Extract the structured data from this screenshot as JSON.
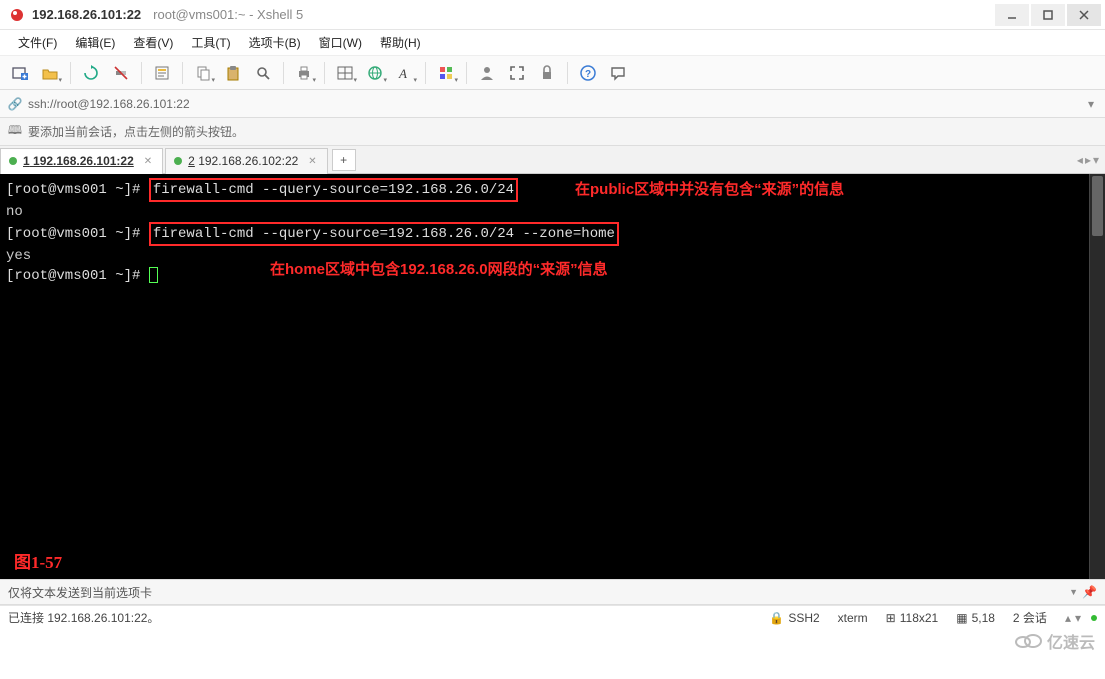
{
  "window": {
    "title_main": "192.168.26.101:22",
    "title_sub": "root@vms001:~ - Xshell 5"
  },
  "menu": {
    "file": "文件(F)",
    "edit": "编辑(E)",
    "view": "查看(V)",
    "tools": "工具(T)",
    "tabs": "选项卡(B)",
    "window": "窗口(W)",
    "help": "帮助(H)"
  },
  "address": {
    "url": "ssh://root@192.168.26.101:22"
  },
  "hint": {
    "text": "要添加当前会话，点击左侧的箭头按钮。"
  },
  "tabs": {
    "t1_prefix": "1",
    "t1_label": " 192.168.26.101:22",
    "t2_prefix": "2",
    "t2_label": " 192.168.26.102:22"
  },
  "terminal": {
    "prompt": "[root@vms001 ~]# ",
    "cmd1": "firewall-cmd --query-source=192.168.26.0/24",
    "out1": "no",
    "cmd2": "firewall-cmd --query-source=192.168.26.0/24 --zone=home",
    "out2": "yes",
    "ann1": "在public区域中并没有包含“来源”的信息",
    "ann2": "在home区域中包含192.168.26.0网段的“来源”信息",
    "fig": "图1-57"
  },
  "destbar": {
    "text": "仅将文本发送到当前选项卡"
  },
  "status": {
    "conn": "已连接 192.168.26.101:22。",
    "proto": "SSH2",
    "term": "xterm",
    "size": "118x21",
    "pos": "5,18",
    "sess": "2 会话"
  },
  "watermark": "亿速云"
}
